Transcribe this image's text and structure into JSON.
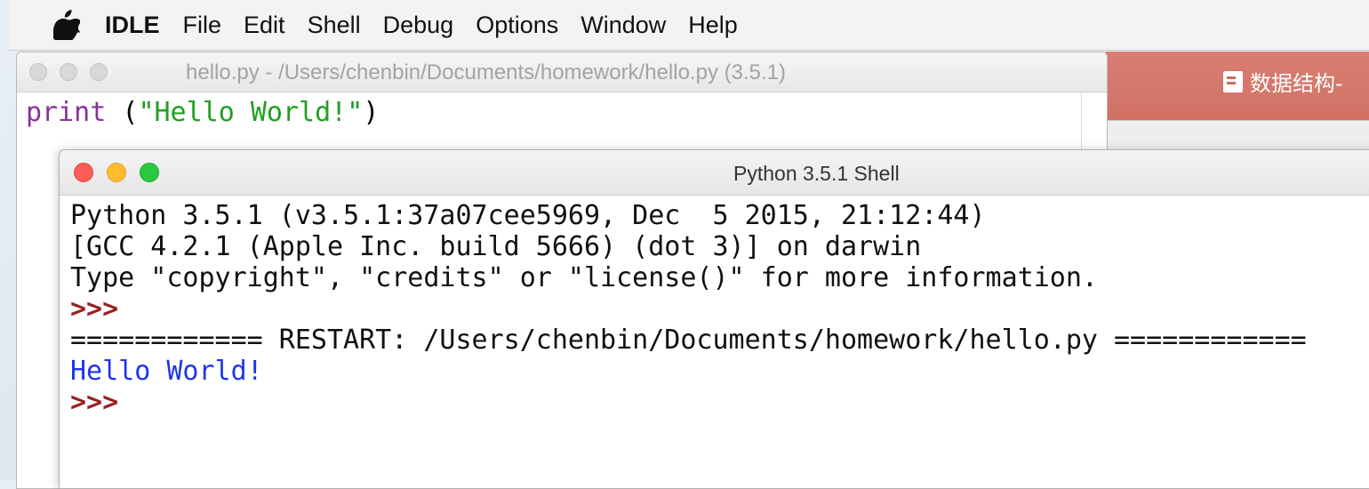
{
  "menubar": {
    "apple_icon": "apple-logo-icon",
    "app_name": "IDLE",
    "items": [
      "File",
      "Edit",
      "Shell",
      "Debug",
      "Options",
      "Window",
      "Help"
    ]
  },
  "editor": {
    "title": "hello.py - /Users/chenbin/Documents/homework/hello.py (3.5.1)",
    "code": {
      "keyword": "print",
      "space": " ",
      "open": "(",
      "string": "\"Hello World!\"",
      "close": ")"
    }
  },
  "background_window": {
    "doc_title": "数据结构-"
  },
  "shell": {
    "title": "Python 3.5.1 Shell",
    "lines": {
      "banner1": "Python 3.5.1 (v3.5.1:37a07cee5969, Dec  5 2015, 21:12:44)",
      "banner2": "[GCC 4.2.1 (Apple Inc. build 5666) (dot 3)] on darwin",
      "banner3": "Type \"copyright\", \"credits\" or \"license()\" for more information.",
      "prompt1": ">>>",
      "restart": "============ RESTART: /Users/chenbin/Documents/homework/hello.py ============",
      "output": "Hello World!",
      "prompt2": ">>>"
    }
  },
  "colors": {
    "keyword": "#883399",
    "string": "#20a020",
    "prompt": "#992222",
    "output": "#1f36e8",
    "close_light": "#fc5f57",
    "minimize_light": "#fdbc2e",
    "zoom_light": "#28c840"
  }
}
